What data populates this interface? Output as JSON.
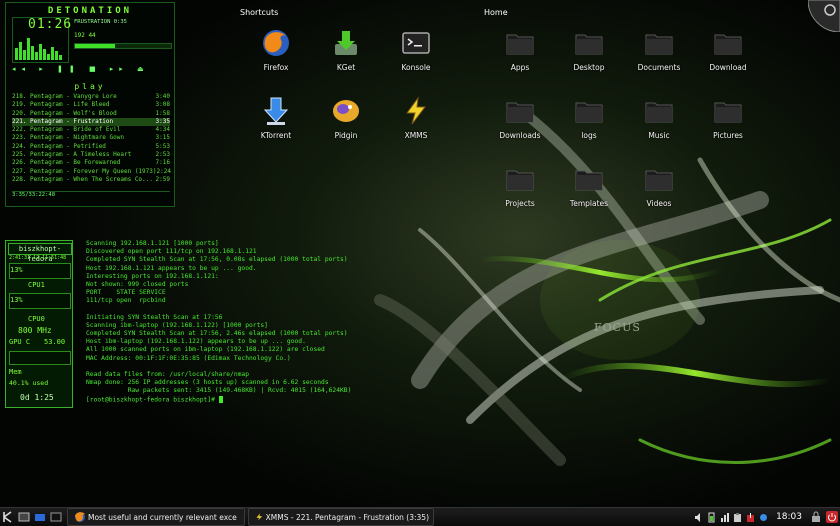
{
  "xmms": {
    "title": "DETONATION",
    "time": "01:26",
    "track_info": "FRUSTRATION  0:35",
    "kbps": "192    44",
    "seek_fraction": 0.42,
    "controls": "◂◂ ▸ ❚❚ ■ ▸▸ ⏏",
    "playlist_title": "play",
    "playlist": [
      {
        "title": "218. Pentagram - Vanygre Lore",
        "time": "3:40"
      },
      {
        "title": "219. Pentagram - Life Bleed",
        "time": "3:08"
      },
      {
        "title": "220. Pentagram - Wolf's Blood",
        "time": "1:58"
      },
      {
        "title": "221. Pentagram - Frustration",
        "time": "3:35"
      },
      {
        "title": "222. Pentagram - Bride of Evil",
        "time": "4:34"
      },
      {
        "title": "223. Pentagram - Nightmare Gown",
        "time": "3:15"
      },
      {
        "title": "224. Pentagram - Petrified",
        "time": "5:53"
      },
      {
        "title": "225. Pentagram - A Timeless Heart",
        "time": "2:53"
      },
      {
        "title": "226. Pentagram - Be Forewarned",
        "time": "7:16"
      },
      {
        "title": "227. Pentagram - Forever My Queen (1973)",
        "time": "2:24"
      },
      {
        "title": "228. Pentagram - When The Screams Co...",
        "time": "2:59"
      }
    ],
    "selected_index": 3,
    "playlist_footer": "3:35/33:22:48"
  },
  "sysmon": {
    "hostname": "biszkhopt-fedora",
    "graph_label": "2:41:31 12 11:51:48",
    "cpu1_pct": "13%",
    "cpu2_label": "CPU0",
    "cpu2_pct": "13%",
    "cpu1_label": "CPU1",
    "freq": "800 MHz",
    "gpu_label": "GPU C",
    "gpu_temp": "53.00",
    "mem_label": "Mem",
    "mem_used": "40.1% used",
    "uptime": "0d 1:25"
  },
  "sections": {
    "shortcuts": "Shortcuts",
    "home": "Home"
  },
  "shortcuts": [
    {
      "label": "Firefox",
      "icon": "firefox-icon"
    },
    {
      "label": "KGet",
      "icon": "kget-icon"
    },
    {
      "label": "Konsole",
      "icon": "konsole-icon"
    },
    {
      "label": "KTorrent",
      "icon": "ktorrent-icon"
    },
    {
      "label": "Pidgin",
      "icon": "pidgin-icon"
    },
    {
      "label": "XMMS",
      "icon": "xmms-icon"
    }
  ],
  "home": [
    {
      "label": "Apps"
    },
    {
      "label": "Desktop"
    },
    {
      "label": "Documents"
    },
    {
      "label": "Download"
    },
    {
      "label": "Downloads"
    },
    {
      "label": "logs"
    },
    {
      "label": "Music"
    },
    {
      "label": "Pictures"
    },
    {
      "label": "Projects"
    },
    {
      "label": "Templates"
    },
    {
      "label": "Videos"
    }
  ],
  "terminal": [
    "Scanning 192.168.1.121 [1000 ports]",
    "Discovered open port 111/tcp on 192.168.1.121",
    "Completed SYN Stealth Scan at 17:56, 0.08s elapsed (1000 total ports)",
    "Host 192.168.1.121 appears to be up ... good.",
    "Interesting ports on 192.168.1.121:",
    "Not shown: 999 closed ports",
    "PORT    STATE SERVICE",
    "111/tcp open  rpcbind",
    "",
    "Initiating SYN Stealth Scan at 17:56",
    "Scanning ibm-laptop (192.168.1.122) [1000 ports]",
    "Completed SYN Stealth Scan at 17:56, 2.46s elapsed (1000 total ports)",
    "Host ibm-laptop (192.168.1.122) appears to be up ... good.",
    "All 1000 scanned ports on ibm-laptop (192.168.1.122) are closed",
    "MAC Address: 00:1F:1F:0E:35:85 (Edimax Technology Co.)",
    "",
    "Read data files from: /usr/local/share/nmap",
    "Nmap done: 256 IP addresses (3 hosts up) scanned in 6.62 seconds",
    "           Raw packets sent: 3415 (149.468KB) | Rcvd: 4015 (164,624KB)"
  ],
  "prompt": "[root@biszkhopt-fedora biszkhopt]# ",
  "focus_text": "FOCUS",
  "taskbar": {
    "task1": "Most useful and currently relevant exce",
    "task2": "XMMS - 221. Pentagram - Frustration (3:35)",
    "clock": "18:03"
  },
  "colors": {
    "accent": "#7fff3a",
    "terminal_text": "#46e830"
  }
}
